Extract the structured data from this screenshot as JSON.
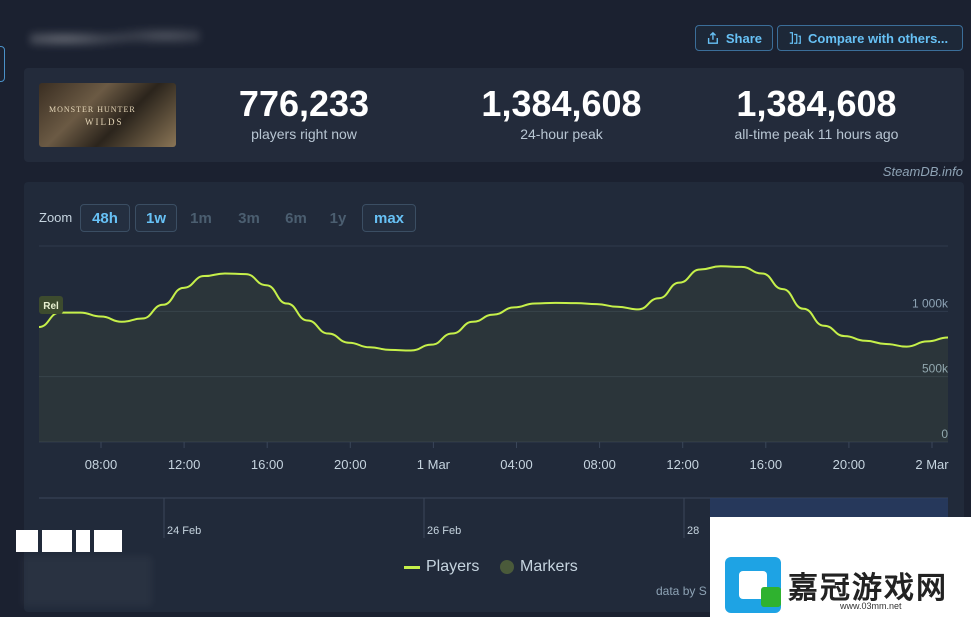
{
  "header": {
    "share_label": "Share",
    "compare_label": "Compare with others..."
  },
  "game": {
    "thumb_title": "MONSTER HUNTER",
    "thumb_subtitle": "WILDS"
  },
  "stats": [
    {
      "value": "776,233",
      "label": "players right now"
    },
    {
      "value": "1,384,608",
      "label": "24-hour peak"
    },
    {
      "value": "1,384,608",
      "label": "all-time peak 11 hours ago"
    }
  ],
  "credit": "SteamDB.info",
  "zoom": {
    "label": "Zoom",
    "options": [
      "48h",
      "1w",
      "1m",
      "3m",
      "6m",
      "1y",
      "max"
    ],
    "active": [
      "48h",
      "1w",
      "max"
    ]
  },
  "chart_data": {
    "type": "area",
    "series": [
      {
        "name": "Players",
        "color": "#c6f04a",
        "x": [
          "04:00",
          "06:00",
          "07:00",
          "08:00",
          "09:00",
          "10:00",
          "11:00",
          "12:00",
          "13:00",
          "14:00",
          "15:00",
          "16:00",
          "17:00",
          "18:00",
          "19:00",
          "20:00",
          "21:00",
          "22:00",
          "23:00",
          "00:00",
          "01:00",
          "02:00",
          "03:00",
          "04:00",
          "05:00",
          "06:00",
          "07:00",
          "08:00",
          "09:00",
          "10:00",
          "11:00",
          "12:00",
          "13:00",
          "14:00",
          "15:00",
          "16:00",
          "17:00",
          "18:00",
          "19:00",
          "20:00",
          "21:00",
          "22:00",
          "23:00",
          "00:00",
          "01:00"
        ],
        "values": [
          880000,
          990000,
          990000,
          960000,
          920000,
          945000,
          1050000,
          1180000,
          1270000,
          1290000,
          1285000,
          1200000,
          1060000,
          930000,
          830000,
          760000,
          725000,
          705000,
          700000,
          745000,
          830000,
          920000,
          975000,
          1030000,
          1060000,
          1065000,
          1063000,
          1055000,
          1035000,
          1015000,
          1100000,
          1220000,
          1320000,
          1345000,
          1340000,
          1290000,
          1170000,
          1020000,
          890000,
          810000,
          775000,
          750000,
          730000,
          770000,
          800000
        ]
      }
    ],
    "x_tick_labels": [
      "08:00",
      "12:00",
      "16:00",
      "20:00",
      "1 Mar",
      "04:00",
      "08:00",
      "12:00",
      "16:00",
      "20:00",
      "2 Mar"
    ],
    "y_ticks": [
      0,
      500000,
      1000000
    ],
    "y_tick_labels": [
      "0",
      "500k",
      "1 000k"
    ],
    "ylim": [
      0,
      1500000
    ],
    "marker": {
      "label": "Rel"
    },
    "navigator_labels": [
      "24 Feb",
      "26 Feb",
      "28"
    ],
    "legend": [
      {
        "label": "Players",
        "kind": "line",
        "color": "#c6f04a"
      },
      {
        "label": "Markers",
        "kind": "dot",
        "color": "#4a5a3a"
      }
    ],
    "legend_position": "bottom-center",
    "grid": true
  },
  "footer": {
    "data_by": "data by S"
  },
  "watermarks": {
    "right_chars": "嘉冠游戏网",
    "right_url": "www.03mm.net"
  }
}
